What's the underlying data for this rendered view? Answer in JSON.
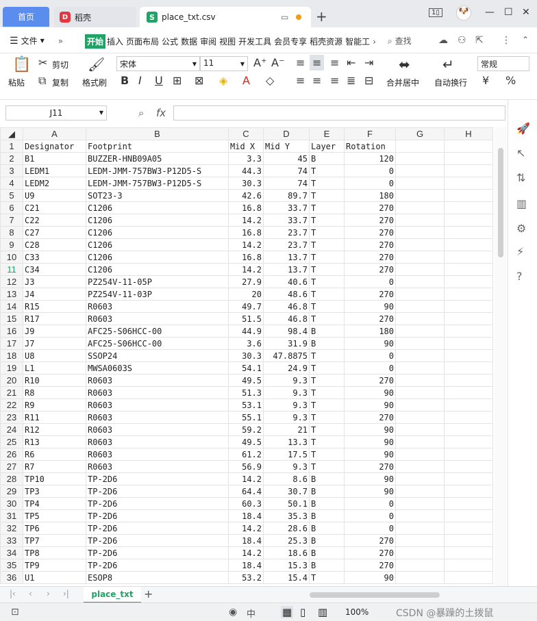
{
  "tabs": {
    "home": "首页",
    "daoke": "稻壳",
    "file": "place_txt.csv"
  },
  "menu": {
    "file": "文件",
    "items": [
      "开始",
      "插入",
      "页面布局",
      "公式",
      "数据",
      "审阅",
      "视图",
      "开发工具",
      "会员专享",
      "稻壳资源",
      "智能工"
    ],
    "search": "查找"
  },
  "ribbon": {
    "paste": "粘贴",
    "cut": "剪切",
    "copy": "复制",
    "format_painter": "格式刷",
    "font": "宋体",
    "size": "11",
    "merge": "合并居中",
    "wrap": "自动换行",
    "number_format": "常规"
  },
  "formula": {
    "cell_ref": "J11",
    "fx": "fx",
    "value": ""
  },
  "columns": [
    "A",
    "B",
    "C",
    "D",
    "E",
    "F",
    "G",
    "H"
  ],
  "rows": [
    [
      "Designator",
      "Footprint",
      "Mid X",
      "Mid Y",
      "Layer",
      "Rotation"
    ],
    [
      "B1",
      "BUZZER-HNB09A05",
      "3.3",
      "45",
      "B",
      "120"
    ],
    [
      "LEDM1",
      "LEDM-JMM-757BW3-P12D5-S",
      "44.3",
      "74",
      "T",
      "0"
    ],
    [
      "LEDM2",
      "LEDM-JMM-757BW3-P12D5-S",
      "30.3",
      "74",
      "T",
      "0"
    ],
    [
      "U9",
      "SOT23-3",
      "42.6",
      "89.7",
      "T",
      "180"
    ],
    [
      "C21",
      "C1206",
      "16.8",
      "33.7",
      "T",
      "270"
    ],
    [
      "C22",
      "C1206",
      "14.2",
      "33.7",
      "T",
      "270"
    ],
    [
      "C27",
      "C1206",
      "16.8",
      "23.7",
      "T",
      "270"
    ],
    [
      "C28",
      "C1206",
      "14.2",
      "23.7",
      "T",
      "270"
    ],
    [
      "C33",
      "C1206",
      "16.8",
      "13.7",
      "T",
      "270"
    ],
    [
      "C34",
      "C1206",
      "14.2",
      "13.7",
      "T",
      "270"
    ],
    [
      "J3",
      "PZ254V-11-05P",
      "27.9",
      "40.6",
      "T",
      "0"
    ],
    [
      "J4",
      "PZ254V-11-03P",
      "20",
      "48.6",
      "T",
      "270"
    ],
    [
      "R15",
      "R0603",
      "49.7",
      "46.8",
      "T",
      "90"
    ],
    [
      "R17",
      "R0603",
      "51.5",
      "46.8",
      "T",
      "270"
    ],
    [
      "J9",
      "AFC25-S06HCC-00",
      "44.9",
      "98.4",
      "B",
      "180"
    ],
    [
      "J7",
      "AFC25-S06HCC-00",
      "3.6",
      "31.9",
      "B",
      "90"
    ],
    [
      "U8",
      "SSOP24",
      "30.3",
      "47.8875",
      "T",
      "0"
    ],
    [
      "L1",
      "MWSA0603S",
      "54.1",
      "24.9",
      "T",
      "0"
    ],
    [
      "R10",
      "R0603",
      "49.5",
      "9.3",
      "T",
      "270"
    ],
    [
      "R8",
      "R0603",
      "51.3",
      "9.3",
      "T",
      "90"
    ],
    [
      "R9",
      "R0603",
      "53.1",
      "9.3",
      "T",
      "90"
    ],
    [
      "R11",
      "R0603",
      "55.1",
      "9.3",
      "T",
      "270"
    ],
    [
      "R12",
      "R0603",
      "59.2",
      "21",
      "T",
      "90"
    ],
    [
      "R13",
      "R0603",
      "49.5",
      "13.3",
      "T",
      "90"
    ],
    [
      "R6",
      "R0603",
      "61.2",
      "17.5",
      "T",
      "90"
    ],
    [
      "R7",
      "R0603",
      "56.9",
      "9.3",
      "T",
      "270"
    ],
    [
      "TP10",
      "TP-2D6",
      "14.2",
      "8.6",
      "B",
      "90"
    ],
    [
      "TP3",
      "TP-2D6",
      "64.4",
      "30.7",
      "B",
      "90"
    ],
    [
      "TP4",
      "TP-2D6",
      "60.3",
      "50.1",
      "B",
      "0"
    ],
    [
      "TP5",
      "TP-2D6",
      "18.4",
      "35.3",
      "B",
      "0"
    ],
    [
      "TP6",
      "TP-2D6",
      "14.2",
      "28.6",
      "B",
      "0"
    ],
    [
      "TP7",
      "TP-2D6",
      "18.4",
      "25.3",
      "B",
      "270"
    ],
    [
      "TP8",
      "TP-2D6",
      "14.2",
      "18.6",
      "B",
      "270"
    ],
    [
      "TP9",
      "TP-2D6",
      "18.4",
      "15.3",
      "B",
      "270"
    ],
    [
      "U1",
      "ESOP8",
      "53.2",
      "15.4",
      "T",
      "90"
    ]
  ],
  "selected_row": 11,
  "sheet_tab": "place_txt",
  "status": {
    "zoom": "100%",
    "watermark": "CSDN @暴躁的土拨鼠"
  }
}
